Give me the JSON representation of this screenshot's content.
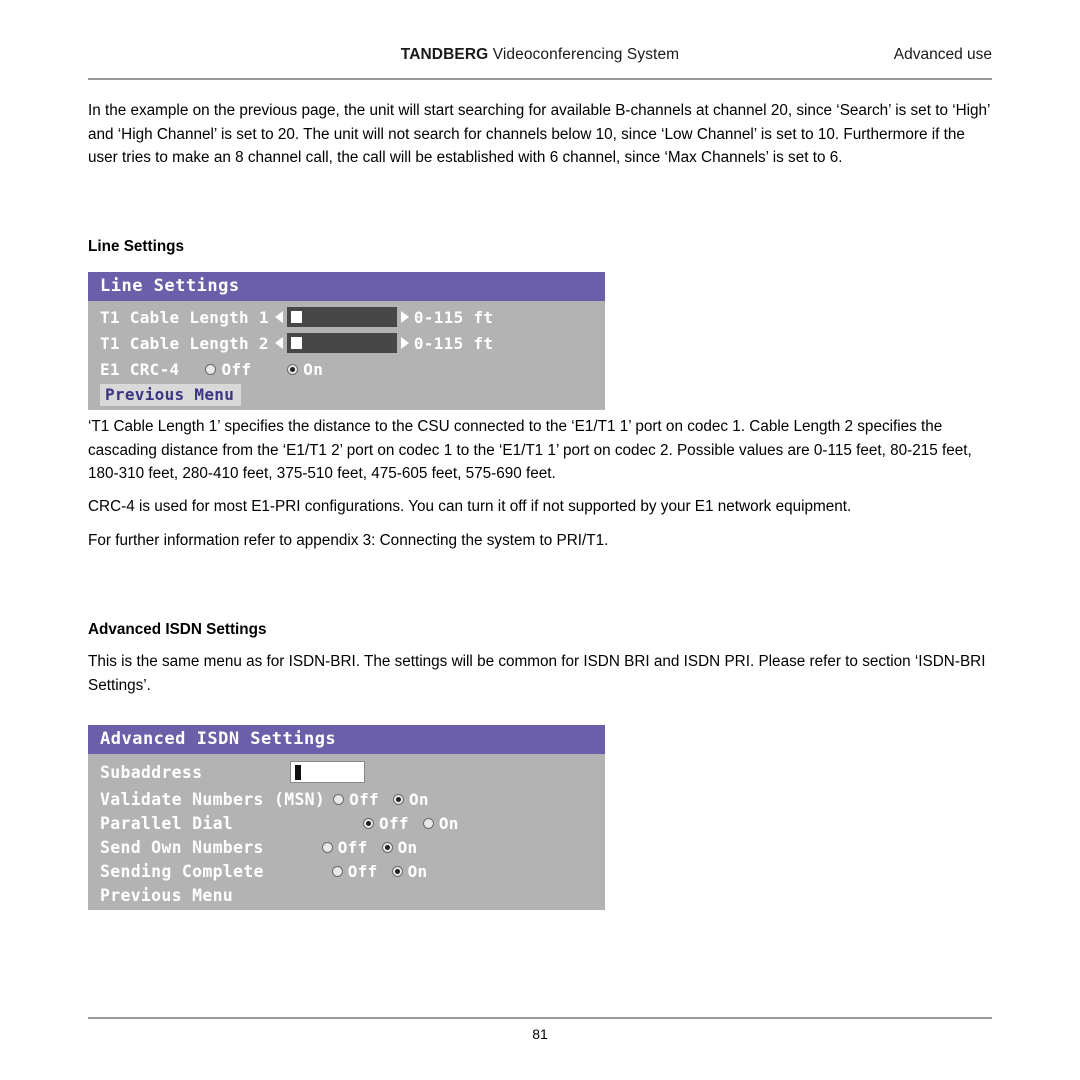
{
  "header": {
    "brand": "TANDBERG",
    "title_rest": " Videoconferencing System",
    "right": "Advanced use"
  },
  "paragraphs": {
    "p1": "In the example on the previous page, the unit will start searching for available B-channels at channel 20, since ‘Search’ is set to ‘High’ and ‘High Channel’ is set to 20. The unit will not search for channels below 10, since ‘Low Channel’ is set to 10. Furthermore if the user tries to make an 8 channel call, the call will be established with 6 channel, since ‘Max Channels’ is set to 6.",
    "p2": "‘T1 Cable Length 1’ specifies the distance to the CSU connected to the ‘E1/T1 1’ port on codec 1. Cable Length 2 specifies the cascading distance from the ‘E1/T1 2’ port on codec 1 to the ‘E1/T1 1’ port on codec 2. Possible values are 0-115 feet, 80-215 feet, 180-310 feet, 280-410 feet, 375-510 feet, 475-605 feet, 575-690 feet.",
    "p3": "CRC-4 is used for most E1-PRI configurations. You can turn it off if not supported by your E1 network equipment.",
    "p4": "For further information refer to appendix 3: Connecting the system to PRI/T1.",
    "p5": "This is the same menu as for ISDN-BRI. The settings will be common for ISDN BRI and ISDN PRI. Please refer to section ‘ISDN-BRI Settings’."
  },
  "headings": {
    "line_settings": "Line Settings",
    "advanced_isdn": "Advanced ISDN Settings"
  },
  "line_settings_menu": {
    "title": "Line Settings",
    "rows": [
      {
        "label": "T1 Cable Length 1",
        "value": "0-115 ft"
      },
      {
        "label": "T1 Cable Length 2",
        "value": "0-115 ft"
      }
    ],
    "crc": {
      "label": "E1 CRC-4",
      "off_label": "Off",
      "on_label": "On",
      "selected": "On"
    },
    "previous_menu": "Previous Menu"
  },
  "advanced_isdn_menu": {
    "title": "Advanced ISDN Settings",
    "subaddress": {
      "label": "Subaddress",
      "value": ""
    },
    "toggles": [
      {
        "label": "Validate Numbers (MSN)",
        "off_label": "Off",
        "on_label": "On",
        "selected": "On"
      },
      {
        "label": "Parallel Dial",
        "off_label": "Off",
        "on_label": "On",
        "selected": "Off"
      },
      {
        "label": "Send Own Numbers",
        "off_label": "Off",
        "on_label": "On",
        "selected": "On"
      },
      {
        "label": "Sending Complete",
        "off_label": "Off",
        "on_label": "On",
        "selected": "On"
      }
    ],
    "previous_menu": "Previous Menu"
  },
  "footer": {
    "page_number": "81"
  }
}
